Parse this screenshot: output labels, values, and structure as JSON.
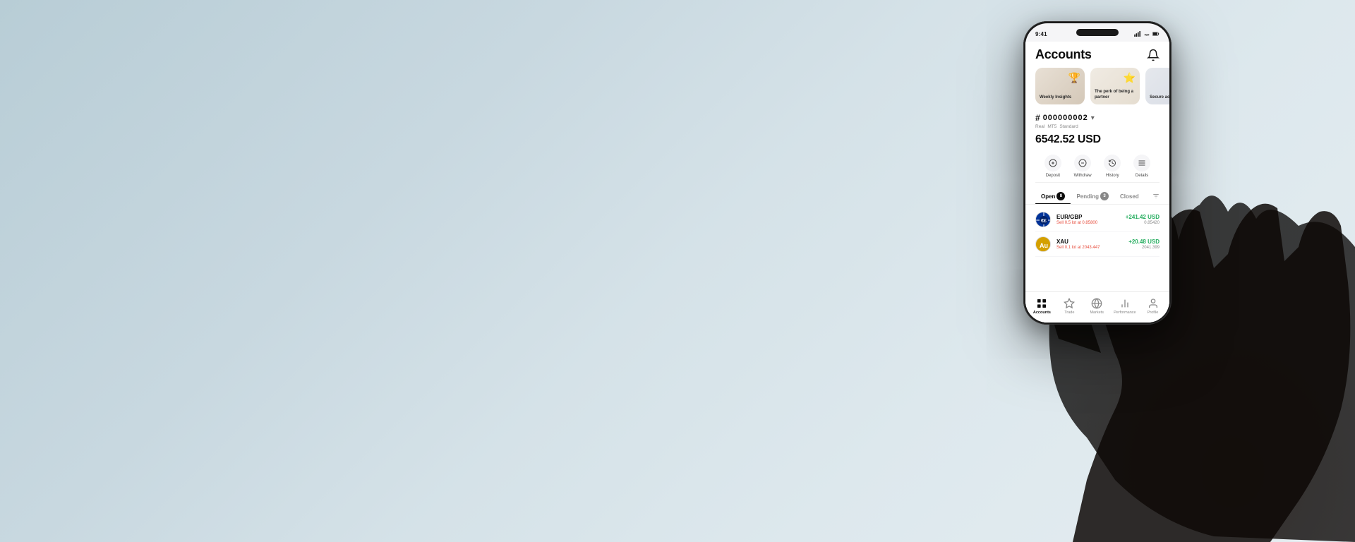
{
  "background": {
    "gradient_start": "#b8cdd6",
    "gradient_end": "#e5edf1"
  },
  "phone": {
    "status_bar": {
      "time": "9:41",
      "signal_icon": "signal-bars",
      "wifi_icon": "wifi",
      "battery_icon": "battery"
    },
    "header": {
      "title": "Accounts",
      "bell_icon": "bell"
    },
    "promo_cards": [
      {
        "id": "weekly",
        "title": "Weekly Insights",
        "icon": "🏆",
        "bg": "warm"
      },
      {
        "id": "partner",
        "title": "The perk of being a partner",
        "icon": "🌟",
        "bg": "cream"
      },
      {
        "id": "secure",
        "title": "Secure acco...",
        "icon": "🔒",
        "bg": "gray"
      }
    ],
    "account": {
      "hash_symbol": "#",
      "number": "000000002",
      "chevron": "▾",
      "tags": [
        "Real",
        "MT5",
        "Standard"
      ],
      "balance": "6542.52 USD"
    },
    "actions": [
      {
        "id": "deposit",
        "label": "Deposit",
        "icon": "⊕"
      },
      {
        "id": "withdraw",
        "label": "Withdraw",
        "icon": "⊖"
      },
      {
        "id": "history",
        "label": "History",
        "icon": "⟳"
      },
      {
        "id": "details",
        "label": "Details",
        "icon": "≡"
      }
    ],
    "tabs": [
      {
        "id": "open",
        "label": "Open",
        "count": "8",
        "active": true
      },
      {
        "id": "pending",
        "label": "Pending",
        "count": "3",
        "active": false
      },
      {
        "id": "closed",
        "label": "Closed",
        "count": "",
        "active": false
      }
    ],
    "trades": [
      {
        "pair": "EUR/GBP",
        "type": "Sell",
        "lots": "0.5 lot",
        "at_price": "0.85800",
        "pnl": "+241.42 USD",
        "current_price": "0.85420",
        "flag_type": "eur-gbp"
      },
      {
        "pair": "XAU",
        "type": "Sell",
        "lots": "0.1 lot",
        "at_price": "2043.447",
        "pnl": "+20.48 USD",
        "current_price": "2041.399",
        "flag_type": "xau"
      }
    ],
    "bottom_nav": [
      {
        "id": "accounts",
        "label": "Accounts",
        "icon": "▦",
        "active": true
      },
      {
        "id": "trade",
        "label": "Trade",
        "icon": "⬡",
        "active": false
      },
      {
        "id": "markets",
        "label": "Markets",
        "icon": "🌐",
        "active": false
      },
      {
        "id": "performance",
        "label": "Performance",
        "icon": "📊",
        "active": false
      },
      {
        "id": "profile",
        "label": "Profile",
        "icon": "👤",
        "active": false
      }
    ]
  }
}
